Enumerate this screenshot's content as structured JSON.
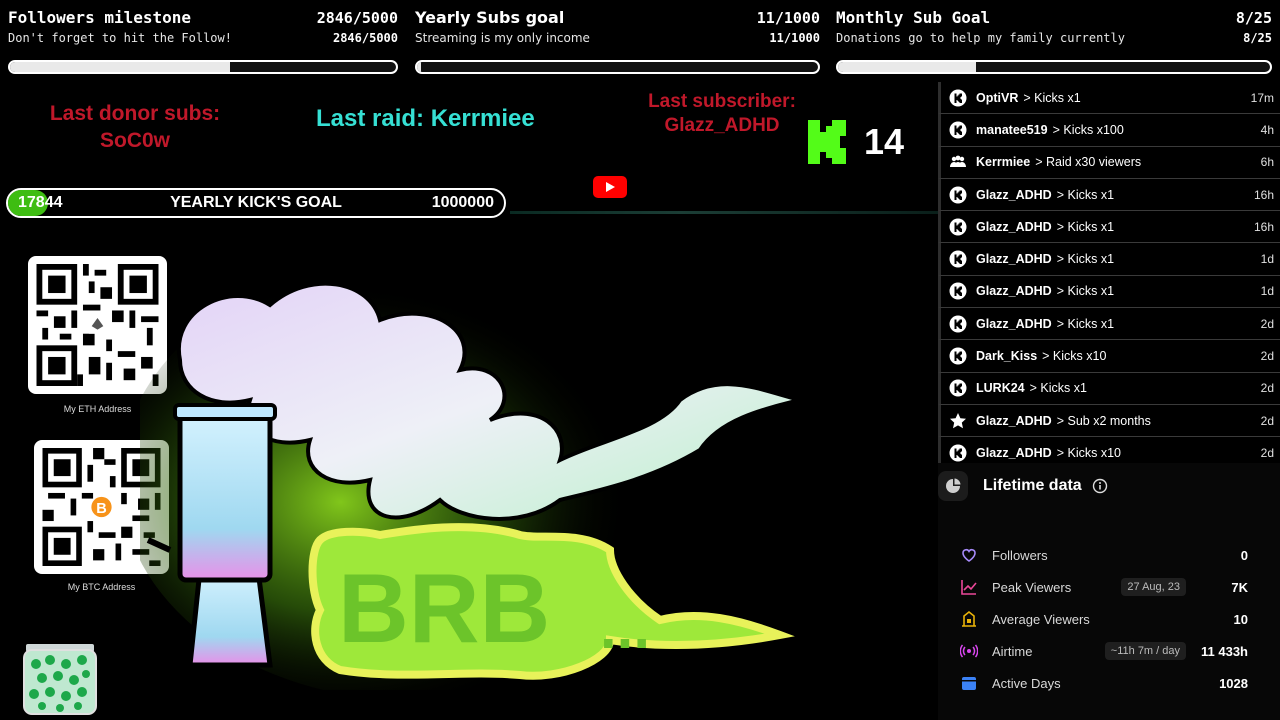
{
  "goals": [
    {
      "title": "Followers milestone",
      "count": "2846/5000",
      "subtitle": "Don't forget to hit the Follow!",
      "subcount": "2846/5000",
      "progress": 0.5692
    },
    {
      "title": "Yearly Subs goal",
      "count": "11/1000",
      "subtitle": "Streaming is my only income",
      "subcount": "11/1000",
      "progress": 0.011
    },
    {
      "title": "Monthly Sub Goal",
      "count": "8/25",
      "subtitle": "Donations go to help my family currently",
      "subcount": "8/25",
      "progress": 0.32
    }
  ],
  "labels": {
    "last_donor_title": "Last donor subs:",
    "last_donor_name": "SoC0w",
    "last_raid": "Last raid: Kerrmiee",
    "last_sub_title": "Last subscriber:",
    "last_sub_name": "Glazz_ADHD",
    "kick_count": "14"
  },
  "yearly_goal": {
    "current": "17844",
    "label": "YEARLY KICK'S GOAL",
    "target": "1000000",
    "progress": 0.017844
  },
  "qr": {
    "eth_label": "My ETH Address",
    "btc_label": "My BTC Address"
  },
  "feed": [
    {
      "user": "OptiVR",
      "action": "> Kicks x1",
      "time": "17m",
      "icon": "kick"
    },
    {
      "user": "manatee519",
      "action": "> Kicks x100",
      "time": "4h",
      "icon": "kick"
    },
    {
      "user": "Kerrmiee",
      "action": "> Raid x30 viewers",
      "time": "6h",
      "icon": "raid"
    },
    {
      "user": "Glazz_ADHD",
      "action": "> Kicks x1",
      "time": "16h",
      "icon": "kick"
    },
    {
      "user": "Glazz_ADHD",
      "action": "> Kicks x1",
      "time": "16h",
      "icon": "kick"
    },
    {
      "user": "Glazz_ADHD",
      "action": "> Kicks x1",
      "time": "1d",
      "icon": "kick"
    },
    {
      "user": "Glazz_ADHD",
      "action": "> Kicks x1",
      "time": "1d",
      "icon": "kick"
    },
    {
      "user": "Glazz_ADHD",
      "action": "> Kicks x1",
      "time": "2d",
      "icon": "kick"
    },
    {
      "user": "Dark_Kiss",
      "action": "> Kicks x10",
      "time": "2d",
      "icon": "kick"
    },
    {
      "user": "LURK24",
      "action": "> Kicks x1",
      "time": "2d",
      "icon": "kick"
    },
    {
      "user": "Glazz_ADHD",
      "action": "> Sub x2 months",
      "time": "2d",
      "icon": "star"
    },
    {
      "user": "Glazz_ADHD",
      "action": "> Kicks x10",
      "time": "2d",
      "icon": "kick"
    }
  ],
  "lifetime": {
    "title": "Lifetime data",
    "stats": [
      {
        "label": "Followers",
        "value": "0",
        "tag": "",
        "icon": "heart-icon",
        "color": "#a78bfa"
      },
      {
        "label": "Peak Viewers",
        "value": "7K",
        "tag": "27 Aug, 23",
        "icon": "chart-icon",
        "color": "#ec4899"
      },
      {
        "label": "Average Viewers",
        "value": "10",
        "tag": "",
        "icon": "average-icon",
        "color": "#eab308"
      },
      {
        "label": "Airtime",
        "value": "11 433h",
        "tag": "~11h 7m / day",
        "icon": "broadcast-icon",
        "color": "#d946ef"
      },
      {
        "label": "Active Days",
        "value": "1028",
        "tag": "",
        "icon": "calendar-icon",
        "color": "#3b82f6"
      }
    ]
  },
  "colors": {
    "kick_green": "#53fc18",
    "red": "#c0182a",
    "cyan": "#36e0d4"
  }
}
